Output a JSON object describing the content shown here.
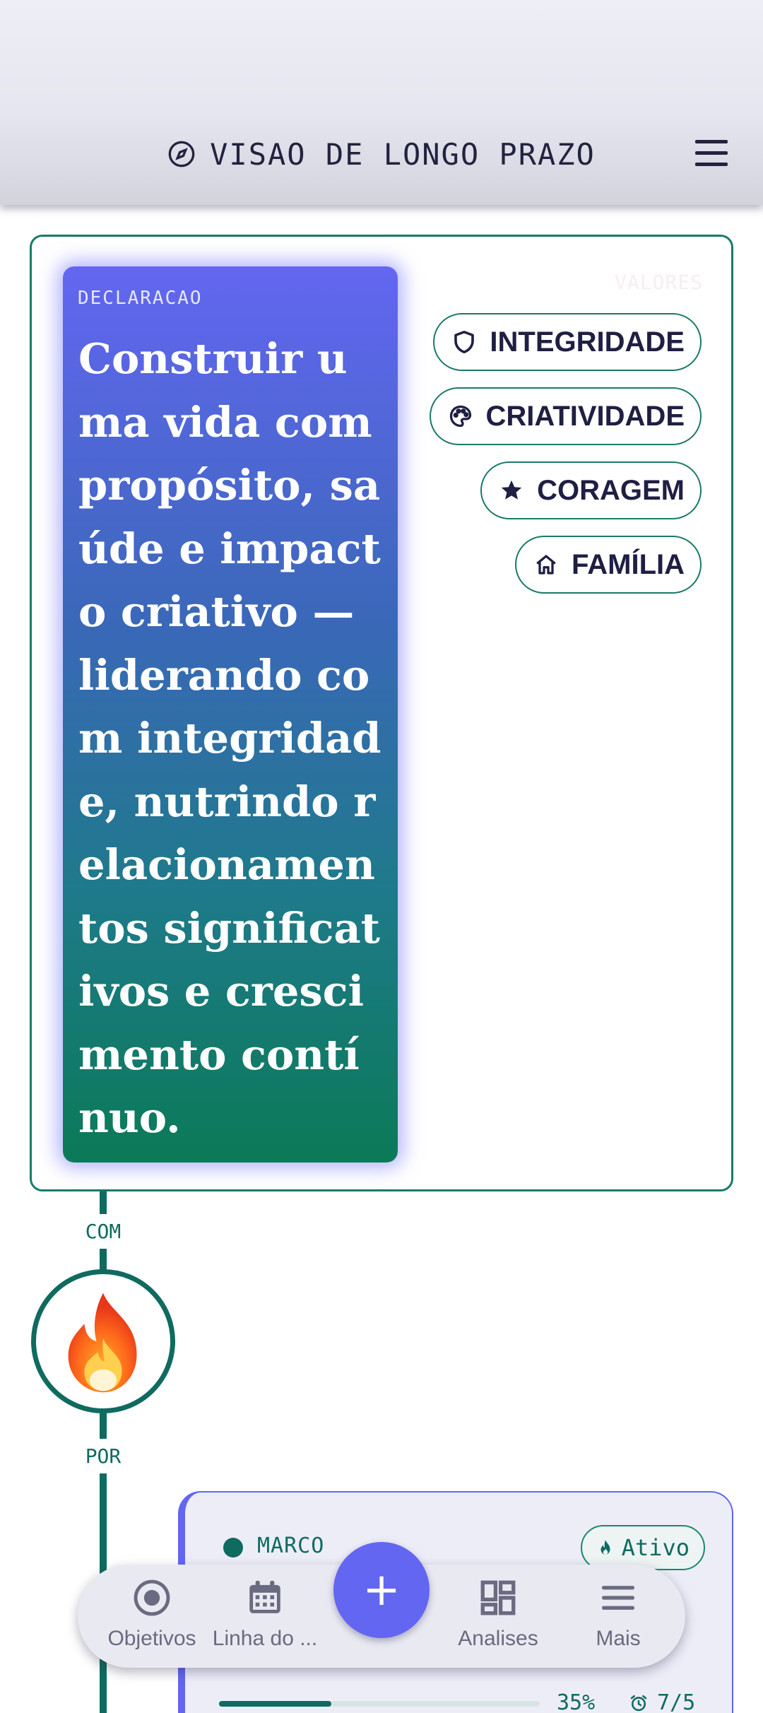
{
  "header": {
    "title": "VISAO DE LONGO PRAZO",
    "title_icon": "compass-icon",
    "menu_icon": "hamburger-menu-icon"
  },
  "statement": {
    "label": "DECLARACAO",
    "text": "Construir uma vida com propósito, saúde e impacto criativo — liderando com integridade, nutrindo relacionamentos significativos e crescimento contínuo."
  },
  "values": {
    "label": "VALORES",
    "items": [
      {
        "label": "INTEGRIDADE",
        "icon": "shield-icon"
      },
      {
        "label": "CRIATIVIDADE",
        "icon": "palette-icon"
      },
      {
        "label": "CORAGEM",
        "icon": "star-icon"
      },
      {
        "label": "FAMÍLIA",
        "icon": "home-icon"
      }
    ]
  },
  "timeline": {
    "label_top": "COM",
    "label_bottom": "POR",
    "emoji": "🔥"
  },
  "milestone": {
    "label": "MARCO",
    "status": "Ativo",
    "progress_percent": 35,
    "progress_text": "35%",
    "count_text": "7/5"
  },
  "nav": {
    "items": [
      {
        "label": "Objetivos",
        "icon": "target-icon"
      },
      {
        "label": "Linha do ...",
        "icon": "calendar-icon"
      },
      {
        "label": "Analises",
        "icon": "dashboard-icon"
      },
      {
        "label": "Mais",
        "icon": "menu-lines-icon"
      }
    ],
    "fab_label": "+"
  },
  "colors": {
    "accent": "#6366f1",
    "teal": "#0f6b5f",
    "header_text": "#23233f"
  }
}
